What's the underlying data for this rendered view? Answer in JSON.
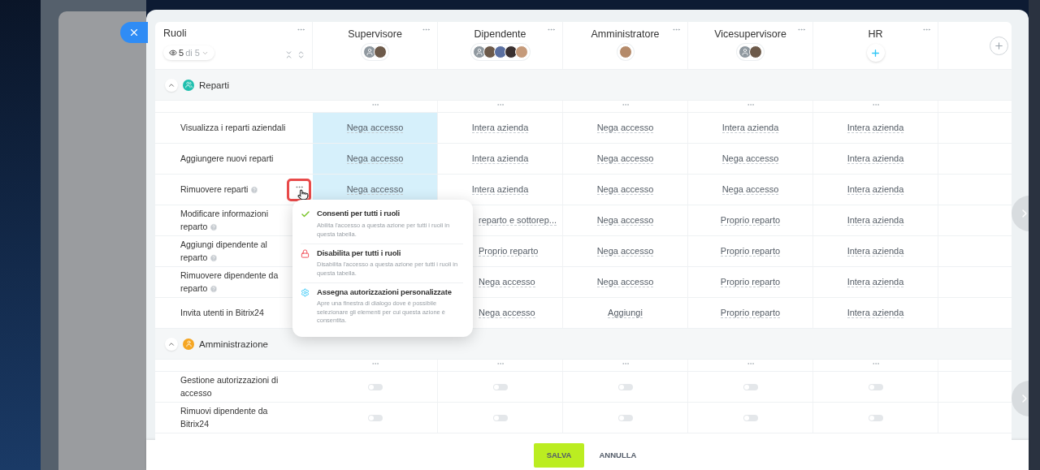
{
  "roles_header": {
    "title": "Ruoli",
    "count": "5",
    "total": "di 5"
  },
  "roles": [
    {
      "name": "Supervisore",
      "highlighted": true,
      "members": [
        {
          "kind": "silhouette"
        },
        {
          "kind": "photo"
        }
      ]
    },
    {
      "name": "Dipendente",
      "highlighted": false,
      "members": [
        {
          "kind": "silhouette"
        },
        {
          "kind": "photo"
        },
        {
          "kind": "photo"
        },
        {
          "kind": "photo"
        },
        {
          "kind": "photo"
        }
      ]
    },
    {
      "name": "Amministratore",
      "highlighted": false,
      "members": [
        {
          "kind": "photo"
        }
      ]
    },
    {
      "name": "Vicesupervisore",
      "highlighted": false,
      "members": [
        {
          "kind": "silhouette"
        },
        {
          "kind": "photo"
        }
      ]
    },
    {
      "name": "HR",
      "highlighted": false
    }
  ],
  "sections": [
    {
      "title": "Reparti",
      "color": "#1fbfae",
      "expanded": true,
      "rows": [
        {
          "label": "Visualizza i reparti aziendali",
          "help": false,
          "menu_open": false,
          "cells": [
            "Nega accesso",
            "Intera azienda",
            "Nega accesso",
            "Intera azienda",
            "Intera azienda"
          ]
        },
        {
          "label": "Aggiungere nuovi reparti",
          "help": false,
          "menu_open": false,
          "cells": [
            "Nega accesso",
            "Intera azienda",
            "Nega accesso",
            "Nega accesso",
            "Intera azienda"
          ]
        },
        {
          "label": "Rimuovere reparti",
          "help": true,
          "menu_open": true,
          "cells": [
            "Nega accesso",
            "Intera azienda",
            "Nega accesso",
            "Nega accesso",
            "Intera azienda"
          ]
        },
        {
          "label": "Modificare informazioni reparto",
          "help": true,
          "menu_open": false,
          "cells": [
            null,
            {
              "value": "reparto e sottorep...",
              "cut": true
            },
            "Nega accesso",
            "Proprio reparto",
            "Intera azienda"
          ]
        },
        {
          "label": "Aggiungi dipendente al reparto",
          "help": true,
          "menu_open": false,
          "cells": [
            null,
            {
              "value": "Proprio reparto",
              "cut": true
            },
            "Nega accesso",
            "Proprio reparto",
            "Intera azienda"
          ]
        },
        {
          "label": "Rimuovere dipendente da reparto",
          "help": true,
          "menu_open": false,
          "cells": [
            null,
            {
              "value": "Nega accesso",
              "cut": true
            },
            "Nega accesso",
            "Proprio reparto",
            "Intera azienda"
          ]
        },
        {
          "label": "Invita utenti in Bitrix24",
          "help": false,
          "menu_open": false,
          "cells": [
            null,
            {
              "value": "Nega accesso",
              "cut": true
            },
            "Aggiungi",
            "Proprio reparto",
            "Intera azienda"
          ]
        }
      ]
    },
    {
      "title": "Amministrazione",
      "color": "#f5a623",
      "expanded": true,
      "rows": [
        {
          "label": "Gestione autorizzazioni di accesso",
          "help": false,
          "menu_open": false,
          "toggles": [
            {
              "on": false
            },
            {
              "on": false
            },
            {
              "on": false
            },
            {
              "on": false
            },
            {
              "on": false
            }
          ]
        },
        {
          "label": "Rimuovi dipendente da Bitrix24",
          "help": false,
          "menu_open": false,
          "toggles": [
            {
              "on": false
            },
            {
              "on": false
            },
            {
              "on": false
            },
            {
              "on": false
            },
            {
              "on": false
            }
          ]
        }
      ]
    }
  ],
  "menu": [
    {
      "kind": "allow",
      "title": "Consenti per tutti i ruoli",
      "description": "Abilita l'accesso a questa azione per tutti i ruoli in questa tabella."
    },
    {
      "kind": "deny",
      "title": "Disabilita per tutti i ruoli",
      "description": "Disabilita l'accesso a questa azione per tutti i ruoli in questa tabella."
    },
    {
      "kind": "custom",
      "title": "Assegna autorizzazioni personalizzate",
      "description": "Apre una finestra di dialogo dove è possibile selezionare gli elementi per cui questa azione è consentita."
    }
  ],
  "footer": {
    "save": "SALVA",
    "cancel": "ANNULLA"
  }
}
